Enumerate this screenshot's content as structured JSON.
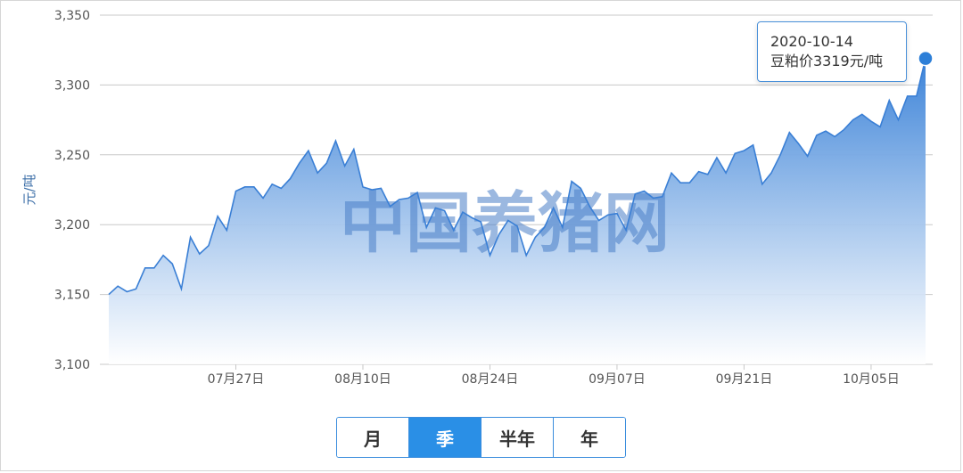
{
  "watermark": "中国养猪网",
  "tooltip": {
    "date": "2020-10-14",
    "text": "豆粕价3319元/吨"
  },
  "period_buttons": [
    {
      "label": "月",
      "active": false
    },
    {
      "label": "季",
      "active": true
    },
    {
      "label": "半年",
      "active": false
    },
    {
      "label": "年",
      "active": false
    }
  ],
  "colors": {
    "line": "#3a7fd5",
    "area_top": "#3c83d8",
    "area_bottom": "#ffffff",
    "grid": "#c8c8c8",
    "marker": "#2d7fd8"
  },
  "chart_data": {
    "type": "area",
    "title": "",
    "xlabel": "",
    "ylabel": "元/吨",
    "ylim": [
      3100,
      3350
    ],
    "yticks": [
      "3,100",
      "3,150",
      "3,200",
      "3,250",
      "3,300",
      "3,350"
    ],
    "ytick_values": [
      3100,
      3150,
      3200,
      3250,
      3300,
      3350
    ],
    "xtick_labels": [
      "07月27日",
      "08月10日",
      "08月24日",
      "09月07日",
      "09月21日",
      "10月05日"
    ],
    "xtick_index": [
      14,
      28,
      42,
      56,
      70,
      84
    ],
    "grid": true,
    "legend": "none",
    "x": [
      "07/13",
      "07/14",
      "07/15",
      "07/16",
      "07/17",
      "07/18",
      "07/19",
      "07/20",
      "07/21",
      "07/22",
      "07/23",
      "07/24",
      "07/25",
      "07/26",
      "07/27",
      "07/28",
      "07/29",
      "07/30",
      "07/31",
      "08/01",
      "08/02",
      "08/03",
      "08/04",
      "08/05",
      "08/06",
      "08/07",
      "08/08",
      "08/09",
      "08/10",
      "08/11",
      "08/12",
      "08/13",
      "08/14",
      "08/15",
      "08/16",
      "08/17",
      "08/18",
      "08/19",
      "08/20",
      "08/21",
      "08/22",
      "08/23",
      "08/24",
      "08/25",
      "08/26",
      "08/27",
      "08/28",
      "08/29",
      "08/30",
      "08/31",
      "09/01",
      "09/02",
      "09/03",
      "09/04",
      "09/05",
      "09/06",
      "09/07",
      "09/08",
      "09/09",
      "09/10",
      "09/11",
      "09/12",
      "09/13",
      "09/14",
      "09/15",
      "09/16",
      "09/17",
      "09/18",
      "09/19",
      "09/20",
      "09/21",
      "09/22",
      "09/23",
      "09/24",
      "09/25",
      "09/26",
      "09/27",
      "09/28",
      "09/29",
      "09/30",
      "10/01",
      "10/02",
      "10/03",
      "10/04",
      "10/05",
      "10/06",
      "10/07",
      "10/08",
      "10/09",
      "10/10",
      "10/11",
      "10/12",
      "10/13",
      "10/14"
    ],
    "series": [
      {
        "values": [
          3150,
          3156,
          3152,
          3154,
          3169,
          3169,
          3178,
          3172,
          3154,
          3191,
          3179,
          3185,
          3206,
          3196,
          3224,
          3227,
          3227,
          3219,
          3229,
          3226,
          3233,
          3244,
          3253,
          3237,
          3244,
          3260,
          3242,
          3254,
          3227,
          3225,
          3226,
          3213,
          3218,
          3219,
          3223,
          3198,
          3212,
          3210,
          3196,
          3209,
          3205,
          3202,
          3178,
          3193,
          3203,
          3199,
          3178,
          3191,
          3198,
          3212,
          3198,
          3231,
          3226,
          3213,
          3203,
          3207,
          3208,
          3196,
          3222,
          3224,
          3219,
          3220,
          3237,
          3230,
          3230,
          3238,
          3236,
          3248,
          3237,
          3251,
          3253,
          3257,
          3229,
          3237,
          3250,
          3266,
          3258,
          3249,
          3264,
          3267,
          3263,
          3268,
          3275,
          3279,
          3274,
          3270,
          3289,
          3275,
          3292,
          3292,
          3319
        ]
      }
    ]
  }
}
